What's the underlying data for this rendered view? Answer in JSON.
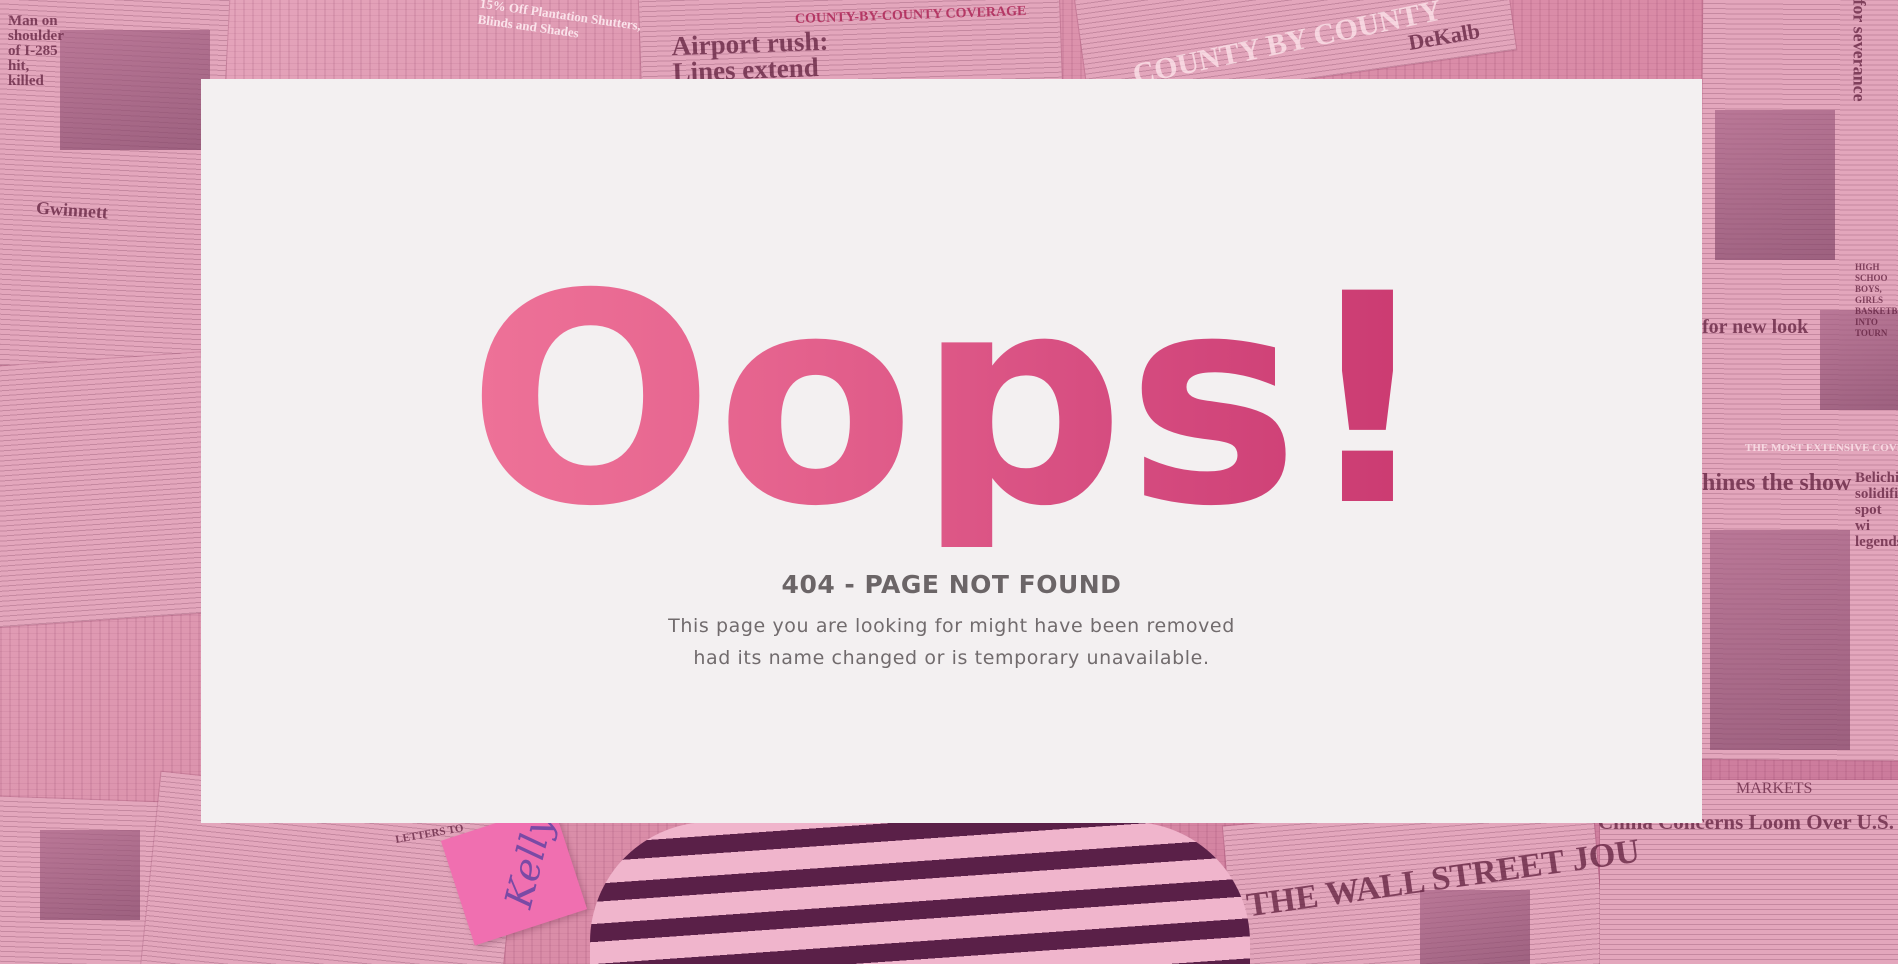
{
  "background": {
    "newspaper_headlines": [
      "Man on shoulder of I-285 hit, killed",
      "15% Off Plantation Shutters, Blinds and Shades",
      "COUNTY-BY-COUNTY COVERAGE",
      "Airport rush: Lines extend",
      "COUNTY BY COUNTY",
      "DeKalb",
      "for severance",
      "Gwinnett",
      "for new look",
      "THE MOST EXTENSIVE COVERAGE",
      "hines the show",
      "Belichi solidifie spot wi legends",
      "MARKETS",
      "China Concerns Loom Over U.S. St",
      "THE WALL STREET JOU",
      "LETTERS TO",
      "HIGH SCHOO BOYS, GIRLS BASKETBALL INTO TOURN"
    ],
    "sticky_note_text": "Kelly"
  },
  "error": {
    "headline": "Oops!",
    "title": "404 - PAGE NOT FOUND",
    "message_line1": "This page you are looking for might have been removed",
    "message_line2": "had its name changed or is temporary unavailable."
  },
  "colors": {
    "background_tint": "#dc93ad",
    "card": "#f3f0f1",
    "headline_gradient_start": "#f67fa1",
    "headline_gradient_end": "#c02a63",
    "text": "#6b6567"
  }
}
